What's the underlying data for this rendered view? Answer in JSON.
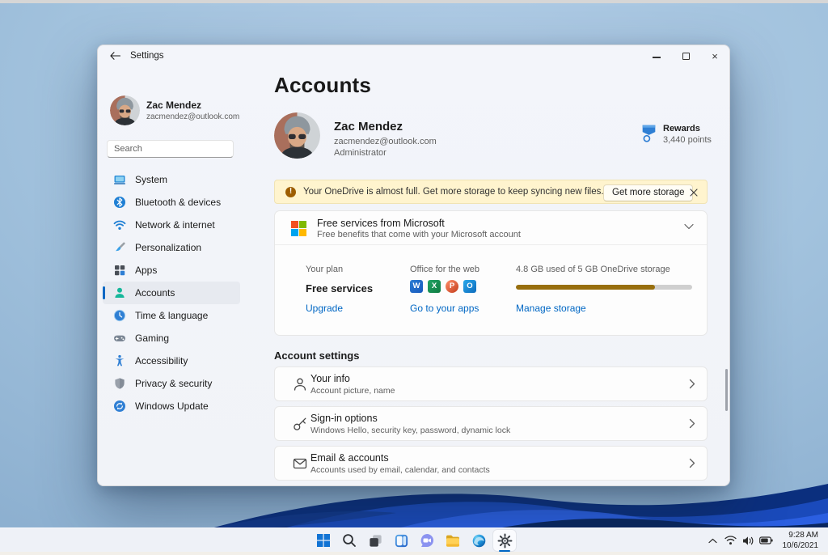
{
  "titlebar": {
    "title": "Settings"
  },
  "sidebar": {
    "user": {
      "name": "Zac Mendez",
      "email": "zacmendez@outlook.com"
    },
    "search_placeholder": "Search",
    "items": [
      {
        "label": "System"
      },
      {
        "label": "Bluetooth & devices"
      },
      {
        "label": "Network & internet"
      },
      {
        "label": "Personalization"
      },
      {
        "label": "Apps"
      },
      {
        "label": "Accounts"
      },
      {
        "label": "Time & language"
      },
      {
        "label": "Gaming"
      },
      {
        "label": "Accessibility"
      },
      {
        "label": "Privacy & security"
      },
      {
        "label": "Windows Update"
      }
    ]
  },
  "content": {
    "page_title": "Accounts",
    "profile": {
      "name": "Zac Mendez",
      "email": "zacmendez@outlook.com",
      "role": "Administrator"
    },
    "rewards": {
      "label": "Rewards",
      "points": "3,440 points"
    },
    "banner": {
      "message": "Your OneDrive is almost full. Get more storage to keep syncing new files.",
      "button_label": "Get more storage"
    },
    "services": {
      "title": "Free services from Microsoft",
      "subtitle": "Free benefits that come with your Microsoft account",
      "plan": {
        "label": "Your plan",
        "value": "Free services",
        "link": "Upgrade"
      },
      "office": {
        "label": "Office for the web",
        "link": "Go to your apps",
        "apps": [
          {
            "letter": "W"
          },
          {
            "letter": "X"
          },
          {
            "letter": "P"
          },
          {
            "letter": "O"
          }
        ]
      },
      "storage": {
        "label": "4.8 GB used of 5 GB OneDrive storage",
        "link": "Manage storage",
        "percent_used": 79
      }
    },
    "account_settings": {
      "heading": "Account settings",
      "rows": [
        {
          "title": "Your info",
          "subtitle": "Account picture, name"
        },
        {
          "title": "Sign-in options",
          "subtitle": "Windows Hello, security key, password, dynamic lock"
        },
        {
          "title": "Email & accounts",
          "subtitle": "Accounts used by email, calendar, and contacts"
        }
      ]
    }
  },
  "taskbar": {
    "tray": {
      "time": "9:28 AM",
      "date": "10/6/2021"
    }
  },
  "colors": {
    "accent": "#0067c4",
    "banner_bg": "#fff4ce",
    "storage_fill": "#986f0e"
  }
}
